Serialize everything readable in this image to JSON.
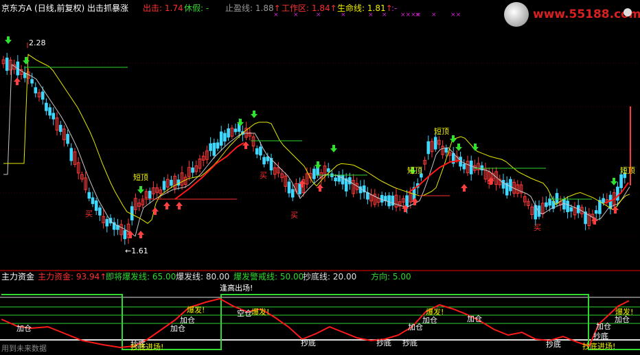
{
  "header": {
    "title": "京东方A (日线,前复权) 出击抓暴涨",
    "items": [
      {
        "label": "出击:",
        "value": "1.74",
        "color": "#ff3030"
      },
      {
        "label": "休假:",
        "value": "-",
        "color": "#30d830"
      },
      {
        "label": "止盈线:",
        "value": "1.88",
        "color": "#9a9a9a"
      },
      {
        "label": "工作区:",
        "value": "1.84",
        "color": "#ff3030"
      },
      {
        "label": "生命线:",
        "value": "1.81",
        "color": "#f0f000"
      },
      {
        "label": ":",
        "value": "-",
        "color": "#d020d0"
      }
    ],
    "arrow": "↑"
  },
  "watermark": {
    "url": "www.55188.com"
  },
  "main_chart": {
    "price_high": "2.28",
    "price_low": "←1.61",
    "signals": {
      "short_top": "短顶",
      "buy": "买"
    },
    "colors": {
      "up": "#ff3a3a",
      "down": "#40d8ff",
      "ma_white": "#d0d0d0",
      "ma_yellow": "#f0f000",
      "ma_red": "#ff1a1a",
      "hline_green": "#30d830"
    }
  },
  "indicator": {
    "title": "主力资金",
    "items": [
      {
        "label": "主力资金:",
        "value": "93.94",
        "color": "#ff3030"
      },
      {
        "label": "即将爆发线:",
        "value": "65.00",
        "color": "#30d830"
      },
      {
        "label": "爆发线:",
        "value": "80.00",
        "color": "#e0e0e0"
      },
      {
        "label": "爆发警戒线:",
        "value": "50.00",
        "color": "#30d830"
      },
      {
        "label": "抄底线:",
        "value": "20.00",
        "color": "#e0e0e0"
      },
      {
        "label": "方向:",
        "value": "5.00",
        "color": "#30d830"
      }
    ],
    "arrow": "↑",
    "signals": {
      "escape_high": "逢高出场!",
      "burst": "爆发!",
      "add": "加仓",
      "bottom": "抄底",
      "empty": "空仓",
      "bottom_entry": "抄底进场!"
    }
  },
  "footer": {
    "text": "用到未来数据"
  }
}
